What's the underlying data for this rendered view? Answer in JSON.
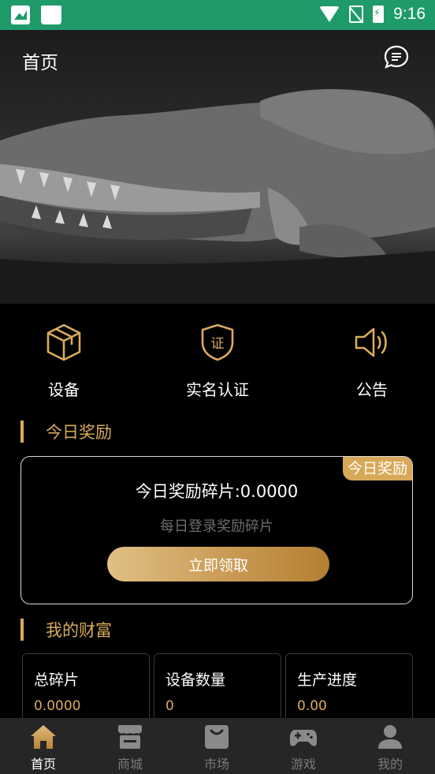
{
  "status_bar": {
    "time": "9:16"
  },
  "header": {
    "title": "首页"
  },
  "quick_entries": [
    {
      "label": "设备",
      "icon": "cube-icon"
    },
    {
      "label": "实名认证",
      "icon": "shield-certificate-icon",
      "icon_text": "证"
    },
    {
      "label": "公告",
      "icon": "speaker-icon"
    }
  ],
  "today_reward": {
    "section_title": "今日奖励",
    "badge": "今日奖励",
    "amount_text": "今日奖励碎片:0.0000",
    "description": "每日登录奖励碎片",
    "claim_button": "立即领取"
  },
  "wealth": {
    "section_title": "我的财富",
    "cards": [
      {
        "label": "总碎片",
        "value": "0.0000"
      },
      {
        "label": "设备数量",
        "value": "0"
      },
      {
        "label": "生产进度",
        "value": "0.00"
      }
    ]
  },
  "tab_bar": {
    "items": [
      {
        "label": "首页",
        "icon": "home-icon",
        "active": true
      },
      {
        "label": "商城",
        "icon": "store-icon",
        "active": false
      },
      {
        "label": "市场",
        "icon": "shopping-bag-icon",
        "active": false
      },
      {
        "label": "游戏",
        "icon": "gamepad-icon",
        "active": false
      },
      {
        "label": "我的",
        "icon": "user-icon",
        "active": false
      }
    ]
  },
  "colors": {
    "status_bar": "#1f9b6a",
    "accent_gold": "#d9ab5c",
    "background": "#000000",
    "tab_bar": "#262626"
  }
}
